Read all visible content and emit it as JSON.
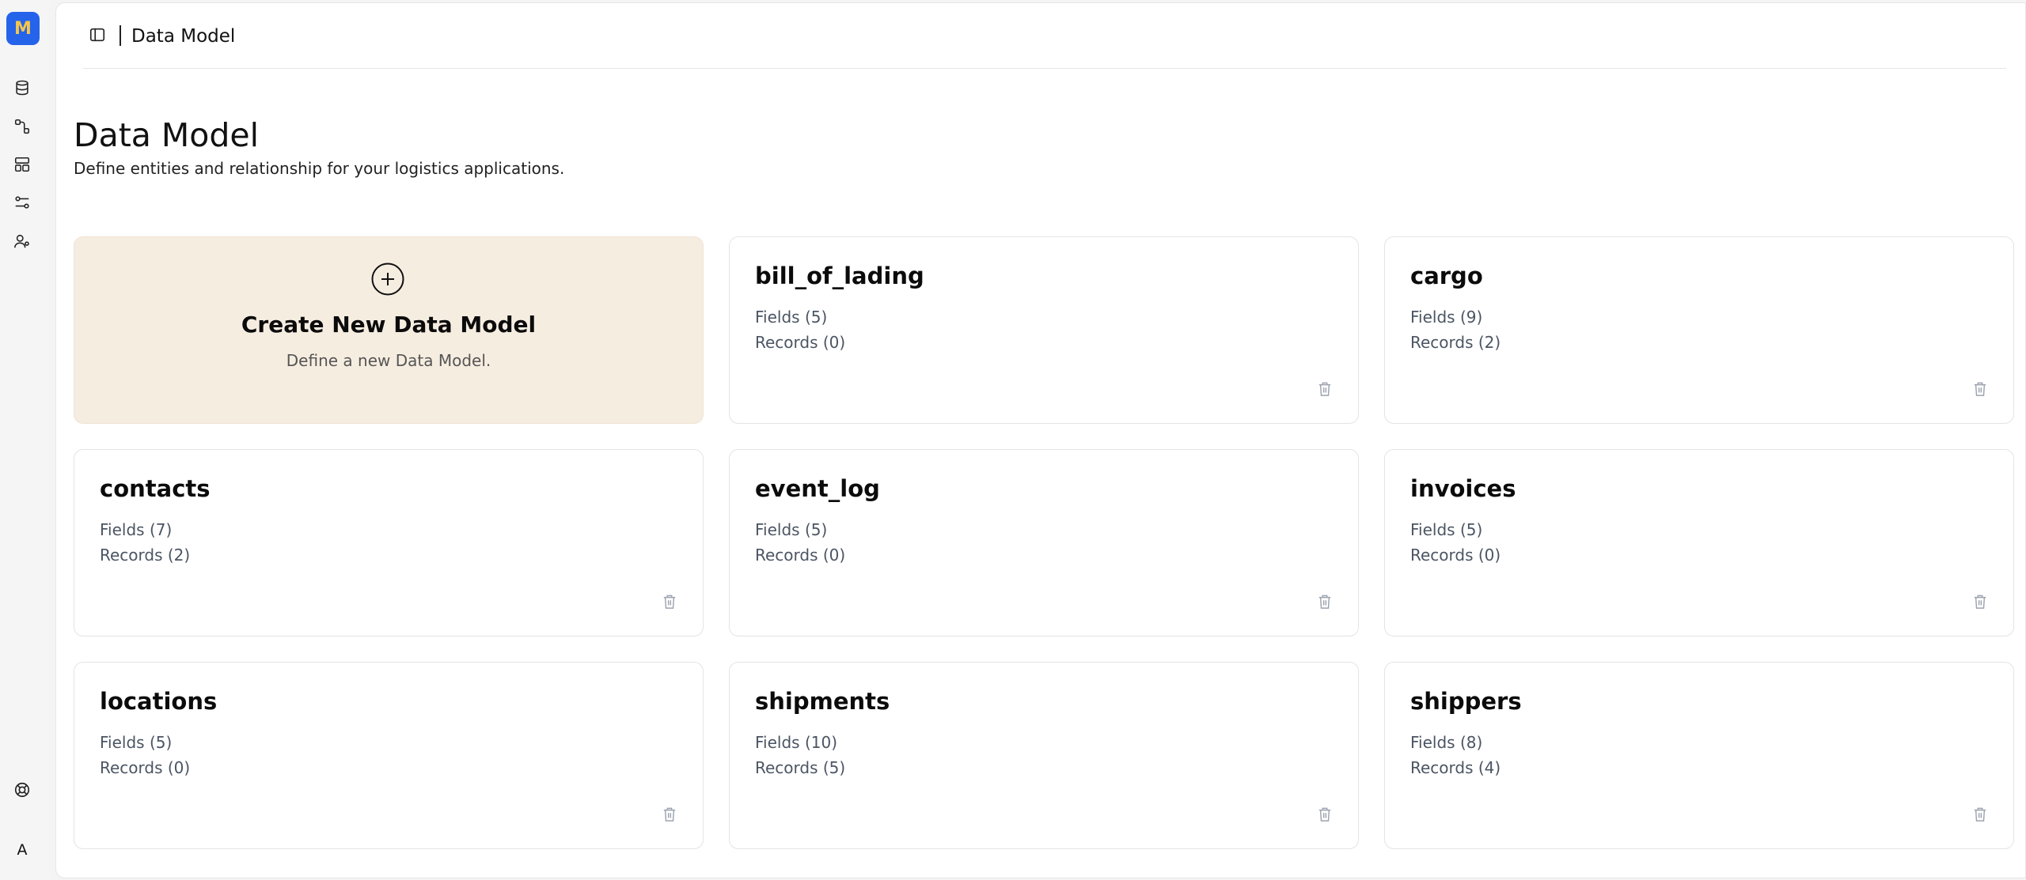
{
  "sidebar": {
    "logo_letter": "M",
    "nav_icons": [
      "database-icon",
      "relationships-icon",
      "layout-icon",
      "settings-sliders-icon",
      "users-icon"
    ],
    "help_icon": "lifebuoy-icon",
    "avatar_letter": "A"
  },
  "header": {
    "toggle_icon": "sidebar-toggle-icon",
    "title": "Data Model"
  },
  "page": {
    "title": "Data Model",
    "subtitle": "Define entities and relationship for your logistics applications."
  },
  "create_card": {
    "icon": "plus-circle-icon",
    "title": "Create New Data Model",
    "subtitle": "Define a new Data Model."
  },
  "models": [
    {
      "name": "bill_of_lading",
      "fields": "Fields (5)",
      "records": "Records (0)"
    },
    {
      "name": "cargo",
      "fields": "Fields (9)",
      "records": "Records (2)"
    },
    {
      "name": "contacts",
      "fields": "Fields (7)",
      "records": "Records (2)"
    },
    {
      "name": "event_log",
      "fields": "Fields (5)",
      "records": "Records (0)"
    },
    {
      "name": "invoices",
      "fields": "Fields (5)",
      "records": "Records (0)"
    },
    {
      "name": "locations",
      "fields": "Fields (5)",
      "records": "Records (0)"
    },
    {
      "name": "shipments",
      "fields": "Fields (10)",
      "records": "Records (5)"
    },
    {
      "name": "shippers",
      "fields": "Fields (8)",
      "records": "Records (4)"
    }
  ],
  "colors": {
    "logo_bg": "#2563eb",
    "logo_letter": "#f6c64a",
    "create_card_bg": "#f6ede1",
    "muted_text": "#4b5563"
  }
}
